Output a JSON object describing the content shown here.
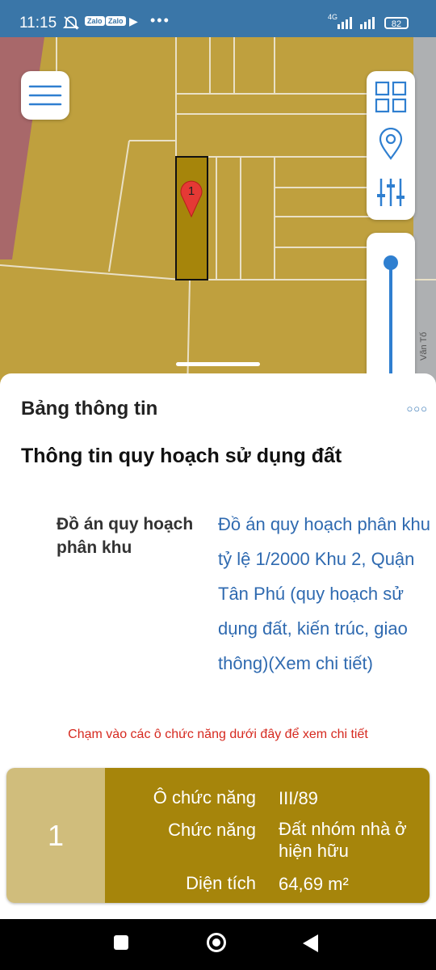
{
  "status_bar": {
    "time": "11:15",
    "app_badge_1": "Zalo",
    "app_badge_2": "Zalo",
    "overflow": "•••",
    "network": "4G",
    "battery": "82"
  },
  "map": {
    "marker_label": "1",
    "street_label": "Văn Tố"
  },
  "sheet": {
    "title": "Bảng thông tin",
    "more": "○○○",
    "section_title": "Thông tin quy hoạch sử dụng đất",
    "plan_label": "Đồ án quy hoạch phân khu",
    "plan_value": "Đồ án quy hoạch phân khu tỷ lệ 1/2000 Khu 2, Quận Tân Phú (quy hoạch sử dụng đất, kiến trúc, giao thông)(Xem chi tiết)",
    "hint": "Chạm vào các ô chức năng dưới đây để xem chi tiết"
  },
  "card": {
    "number": "1",
    "rows": [
      {
        "label": "Ô chức năng",
        "value": "III/89"
      },
      {
        "label": "Chức năng",
        "value": "Đất nhóm nhà ở hiện hữu"
      },
      {
        "label": "Diện tích",
        "value": "64,69 m²"
      }
    ]
  },
  "icons": {
    "menu": "hamburger-menu-icon",
    "layers": "grid-layers-icon",
    "location": "location-pin-icon",
    "filter": "sliders-icon",
    "marker": "map-marker-icon",
    "nav_back": "back-triangle-icon",
    "nav_home": "home-circle-icon",
    "nav_recents": "recents-square-icon"
  },
  "colors": {
    "status_bar": "#3a76a8",
    "map_land": "#bfa03e",
    "map_road": "#aeb0b2",
    "map_residential_pink": "#a8686a",
    "selected_parcel": "#a6850b",
    "accent_blue": "#2f6ab0",
    "hint_red": "#d6291f",
    "card_number_bg": "#d0bd7c",
    "marker_red": "#e53935"
  }
}
